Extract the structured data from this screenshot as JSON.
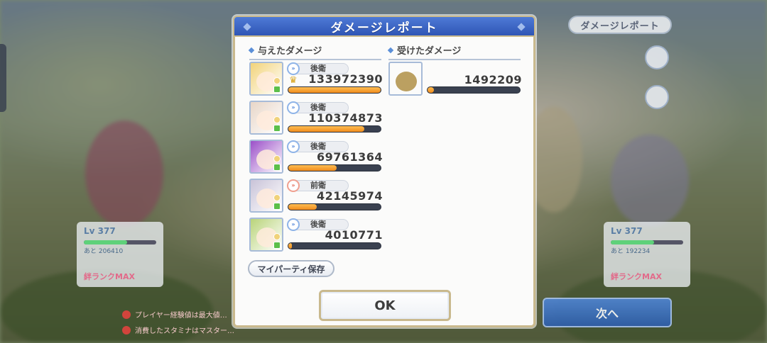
{
  "background": {
    "top_right_button": "ダメージレポート",
    "next_button": "次へ",
    "cards": [
      {
        "level": "Lv 377",
        "exp": "あと 206410",
        "rank": "絆ランクMAX"
      },
      {
        "level": "Lv 377",
        "exp": "あと 192234",
        "rank": "絆ランクMAX"
      }
    ],
    "warnings": [
      "プレイヤー経験値は最大値…",
      "消費したスタミナはマスター…"
    ]
  },
  "dialog": {
    "title": "ダメージレポート",
    "dealt_heading": "与えたダメージ",
    "received_heading": "受けたダメージ",
    "save_party_button": "マイパーティ保存",
    "ok_button": "OK"
  },
  "dealt": [
    {
      "position": "後衛",
      "position_type": "back",
      "damage": "133972390",
      "top": true,
      "fill": 1.0,
      "color": "#f2d37a"
    },
    {
      "position": "後衛",
      "position_type": "back",
      "damage": "110374873",
      "top": false,
      "fill": 0.82,
      "color": "#e8d6c8"
    },
    {
      "position": "後衛",
      "position_type": "back",
      "damage": "69761364",
      "top": false,
      "fill": 0.52,
      "color": "#9b4fc8"
    },
    {
      "position": "前衛",
      "position_type": "front",
      "damage": "42145974",
      "top": false,
      "fill": 0.31,
      "color": "#c9c3d8"
    },
    {
      "position": "後衛",
      "position_type": "back",
      "damage": "4010771",
      "top": false,
      "fill": 0.03,
      "color": "#b9d47a"
    }
  ],
  "received": [
    {
      "damage": "1492209",
      "fill": 0.07,
      "color": "#7a6a34"
    }
  ],
  "icons": {
    "back_position": "arrows-icon",
    "front_position": "arrows-icon",
    "crown": "crown-icon"
  }
}
